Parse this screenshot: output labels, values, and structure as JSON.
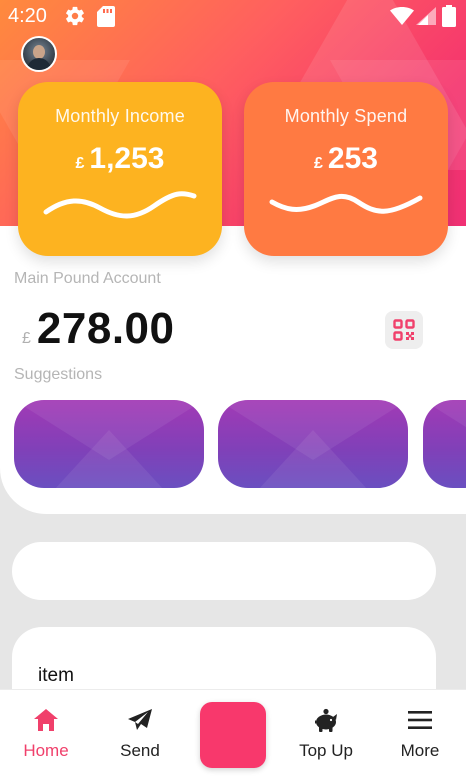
{
  "status_bar": {
    "time": "4:20",
    "icons": [
      "gear-icon",
      "sd-card-icon",
      "wifi-icon",
      "signal-icon",
      "battery-icon"
    ]
  },
  "header": {
    "avatar": "user-avatar"
  },
  "cards": {
    "income": {
      "title": "Monthly Income",
      "currency": "£",
      "amount": "1,253",
      "color": "#fdb320"
    },
    "spend": {
      "title": "Monthly Spend",
      "currency": "£",
      "amount": "253",
      "color": "#ff7a42"
    }
  },
  "account": {
    "label": "Main Pound Account",
    "currency": "£",
    "balance": "278.00",
    "qr_icon": "qr-code-icon"
  },
  "suggestions": {
    "label": "Suggestions",
    "colors": [
      "#a23ab5",
      "#6a4fc0"
    ]
  },
  "list": {
    "item_label": "item"
  },
  "nav": {
    "items": [
      {
        "label": "Home",
        "icon": "home-icon",
        "active": true
      },
      {
        "label": "Send",
        "icon": "send-icon",
        "active": false
      },
      {
        "label": "Top Up",
        "icon": "piggy-bank-icon",
        "active": false
      },
      {
        "label": "More",
        "icon": "menu-icon",
        "active": false
      }
    ],
    "active_color": "#f0406b",
    "center_button_color": "#f8386c"
  },
  "theme": {
    "hero_gradient": [
      "#ff8a3d",
      "#f5356e"
    ]
  }
}
